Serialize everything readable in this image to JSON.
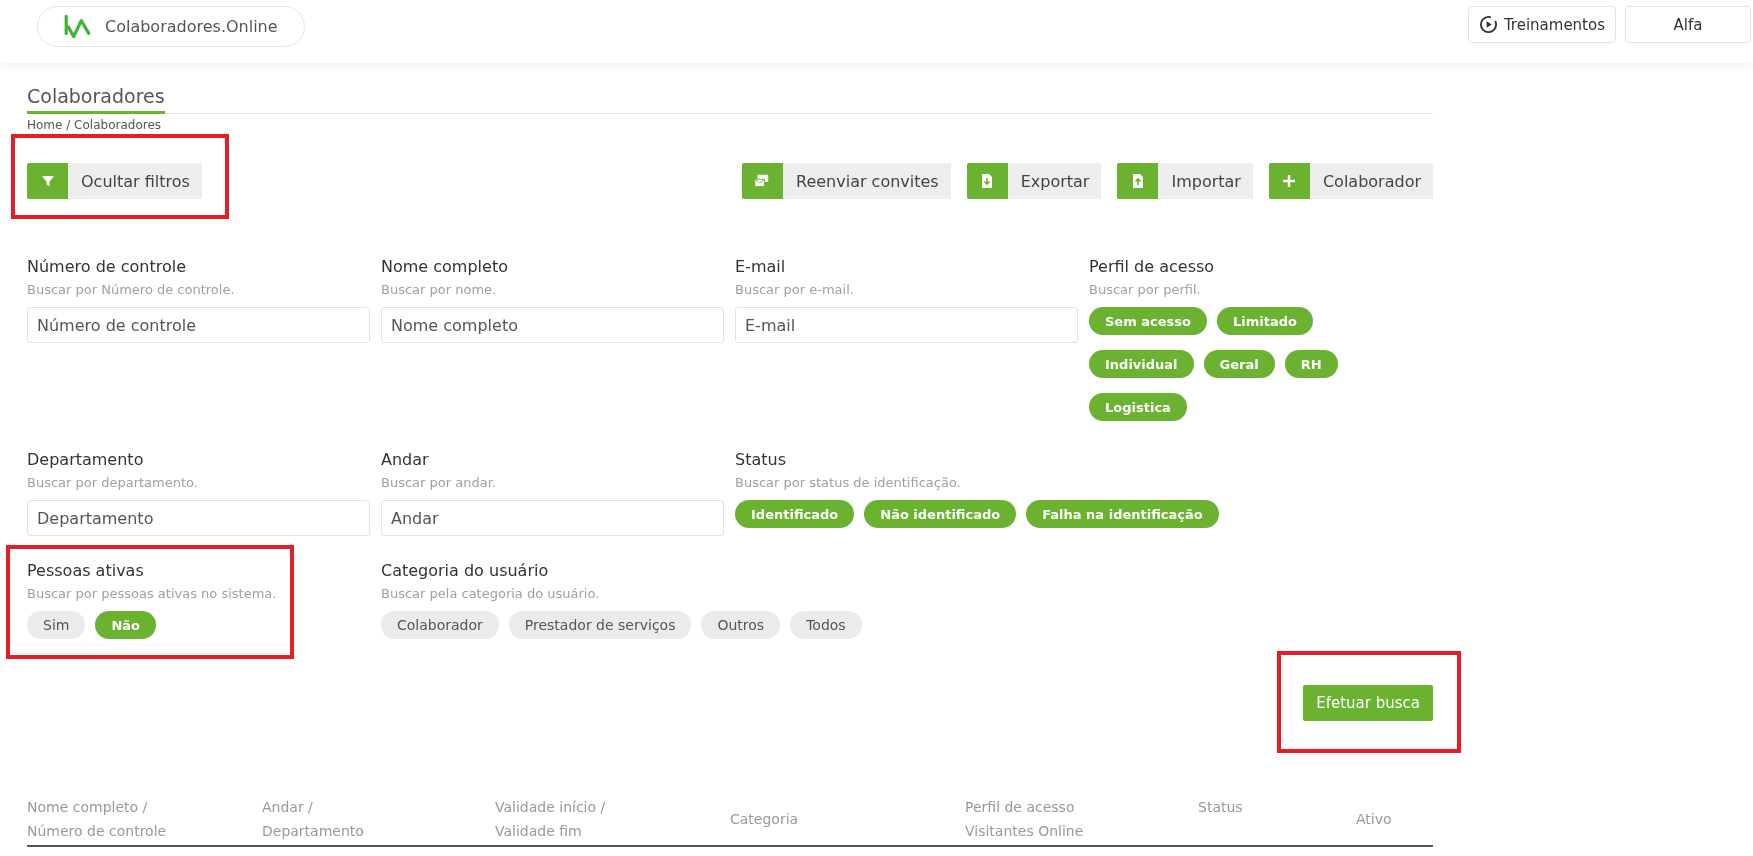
{
  "header": {
    "brand": "Colaboradores.Online",
    "buttons": [
      {
        "label": "Treinamentos"
      },
      {
        "label": "Alfa"
      }
    ]
  },
  "page": {
    "title": "Colaboradores",
    "breadcrumb": "Home / Colaboradores"
  },
  "toolbar": {
    "filter_toggle": {
      "label": "Ocultar filtros",
      "highlighted": true
    },
    "actions": [
      {
        "label": "Reenviar convites"
      },
      {
        "label": "Exportar"
      },
      {
        "label": "Importar"
      },
      {
        "label": "Colaborador"
      }
    ]
  },
  "filters": [
    {
      "kind": "text",
      "label": "Número de controle",
      "hint": "Buscar por Número de controle.",
      "placeholder": "Número de controle",
      "highlighted": false
    },
    {
      "kind": "text",
      "label": "Nome completo",
      "hint": "Buscar por nome.",
      "placeholder": "Nome completo",
      "highlighted": false
    },
    {
      "kind": "text",
      "label": "E-mail",
      "hint": "Buscar por e-mail.",
      "placeholder": "E-mail",
      "highlighted": false
    },
    {
      "kind": "chips",
      "label": "Perfil de acesso",
      "hint": "Buscar por perfil.",
      "highlighted": false,
      "options": [
        {
          "label": "Sem acesso",
          "selected": true
        },
        {
          "label": "Limitado",
          "selected": true
        },
        {
          "label": "Individual",
          "selected": true
        },
        {
          "label": "Geral",
          "selected": true
        },
        {
          "label": "RH",
          "selected": true
        },
        {
          "label": "Logistica",
          "selected": true
        }
      ]
    },
    {
      "kind": "text",
      "label": "Departamento",
      "hint": "Buscar por departamento.",
      "placeholder": "Departamento",
      "highlighted": false
    },
    {
      "kind": "text",
      "label": "Andar",
      "hint": "Buscar por andar.",
      "placeholder": "Andar",
      "highlighted": false
    },
    {
      "kind": "chips",
      "label": "Status",
      "hint": "Buscar por status de identificação.",
      "highlighted": false,
      "options": [
        {
          "label": "Identificado",
          "selected": true
        },
        {
          "label": "Não identificado",
          "selected": true
        },
        {
          "label": "Falha na identificação",
          "selected": true
        }
      ]
    },
    {
      "kind": "chips",
      "label": "Pessoas ativas",
      "hint": "Buscar por pessoas ativas no sistema.",
      "highlighted": true,
      "options": [
        {
          "label": "Sim",
          "selected": false
        },
        {
          "label": "Não",
          "selected": true
        }
      ]
    },
    {
      "kind": "chips",
      "label": "Categoria do usuário",
      "hint": "Buscar pela categoria do usuário.",
      "highlighted": false,
      "options": [
        {
          "label": "Colaborador",
          "selected": false
        },
        {
          "label": "Prestador de serviços",
          "selected": false
        },
        {
          "label": "Outros",
          "selected": false
        },
        {
          "label": "Todos",
          "selected": false
        }
      ]
    }
  ],
  "search_button": {
    "label": "Efetuar busca",
    "highlighted": true
  },
  "table": {
    "columns": [
      {
        "lines": [
          "Nome completo /",
          "Número de controle"
        ]
      },
      {
        "lines": [
          "Andar /",
          "Departamento"
        ]
      },
      {
        "lines": [
          "Validade início /",
          "Validade fim"
        ]
      },
      {
        "lines": [
          "Categoria"
        ]
      },
      {
        "lines": [
          "Perfil de acesso",
          "Visitantes Online"
        ]
      },
      {
        "lines": [
          "Status"
        ]
      },
      {
        "lines": [
          "Ativo"
        ]
      }
    ]
  }
}
